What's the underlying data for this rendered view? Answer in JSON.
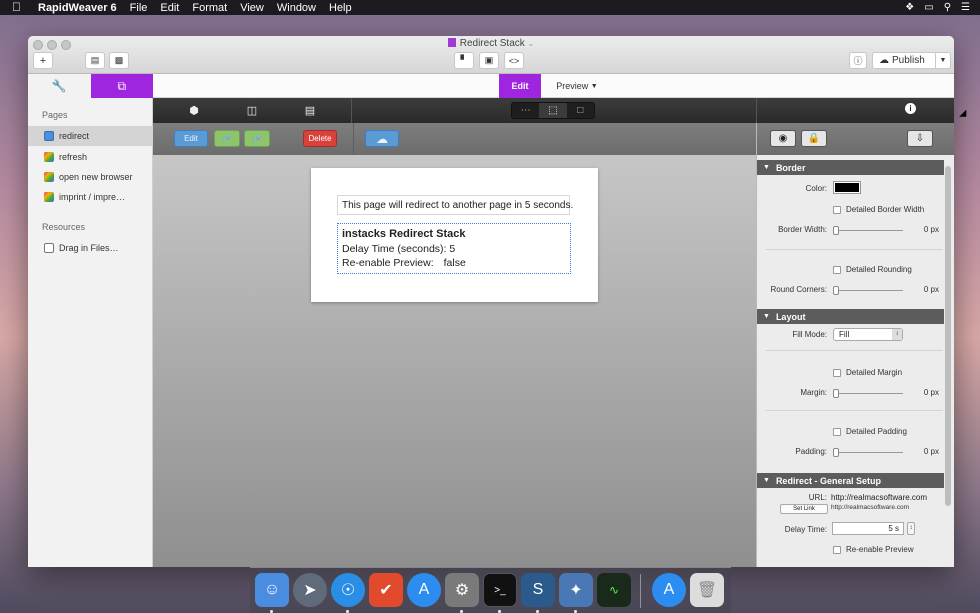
{
  "menubar": {
    "app_name": "RapidWeaver 6",
    "items": [
      "File",
      "Edit",
      "Format",
      "View",
      "Window",
      "Help"
    ]
  },
  "window": {
    "title": "Redirect Stack",
    "publish_label": "Publish"
  },
  "sidebar": {
    "pages_heading": "Pages",
    "pages": [
      {
        "label": "redirect",
        "icon": "page-icon",
        "selected": true
      },
      {
        "label": "refresh",
        "icon": "stacks-page-icon"
      },
      {
        "label": "open new browser",
        "icon": "stacks-page-icon"
      },
      {
        "label": "imprint / impre…",
        "icon": "stacks-page-icon"
      }
    ],
    "resources_heading": "Resources",
    "resources_item": "Drag in Files…"
  },
  "modebar": {
    "edit": "Edit",
    "preview": "Preview"
  },
  "stackbar": {
    "edit": "Edit",
    "delete": "Delete"
  },
  "canvas": {
    "redirect_text": "This page will redirect to another page in 5 seconds.",
    "stack_title": "instacks Redirect Stack",
    "delay_line": "Delay Time (seconds): 5",
    "reenable_label": "Re-enable Preview:",
    "reenable_value": "false"
  },
  "inspector": {
    "border": {
      "header": "Border",
      "color_label": "Color:",
      "color_value": "#000000",
      "detailed_border_width": "Detailed Border Width",
      "border_width_label": "Border Width:",
      "border_width_value": "0 px",
      "detailed_rounding": "Detailed Rounding",
      "round_corners_label": "Round Corners:",
      "round_corners_value": "0 px"
    },
    "layout": {
      "header": "Layout",
      "fill_mode_label": "Fill Mode:",
      "fill_mode_value": "Fill",
      "detailed_margin": "Detailed Margin",
      "margin_label": "Margin:",
      "margin_value": "0 px",
      "detailed_padding": "Detailed Padding",
      "padding_label": "Padding:",
      "padding_value": "0 px"
    },
    "redirect": {
      "header": "Redirect - General Setup",
      "url_label": "URL:",
      "url_value": "http://realmacsoftware.com",
      "url_small": "http://realmacsoftware.com",
      "set_link": "Set Link",
      "delay_label": "Delay Time:",
      "delay_value": "5 s",
      "reenable": "Re-enable Preview"
    }
  },
  "colors": {
    "accent": "#a025df",
    "delete": "#d9413b",
    "edit_btn": "#5b9bd5",
    "link_btn": "#8fc46f"
  }
}
